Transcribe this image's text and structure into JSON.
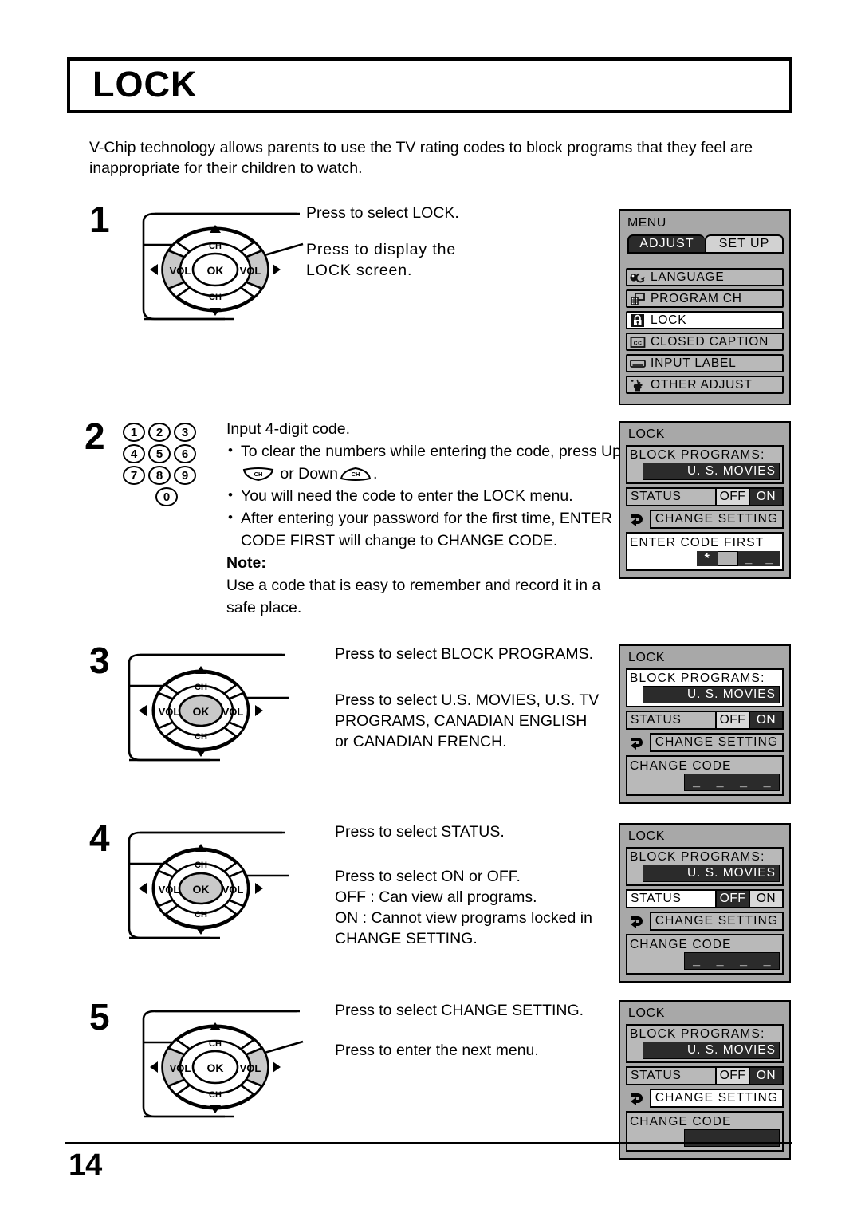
{
  "page": {
    "title": "LOCK",
    "intro": "V-Chip technology allows parents to use the TV rating codes to block programs that they feel are inappropriate for their children to watch.",
    "number": "14"
  },
  "steps": [
    {
      "num": "1",
      "callouts": [
        "Press to select LOCK.",
        "Press to display the\nLOCK screen."
      ]
    },
    {
      "num": "2",
      "lead": "Input 4-digit code.",
      "bullets": [
        "To clear the numbers while entering the code, press Up",
        "You will need the code to enter the LOCK menu.",
        "After entering your password for the first time, ENTER CODE FIRST will change to CHANGE CODE."
      ],
      "bullet1_tail": " or Down",
      "bullet1_end": ".",
      "note_label": "Note:",
      "note_text": "Use a code that is easy to remember and record it in a safe place.",
      "keypad": [
        [
          "1",
          "2",
          "3"
        ],
        [
          "4",
          "5",
          "6"
        ],
        [
          "7",
          "8",
          "9"
        ],
        [
          "0"
        ]
      ],
      "ch_button_label": "CH"
    },
    {
      "num": "3",
      "callouts": [
        "Press to select BLOCK PROGRAMS.",
        "Press to select U.S. MOVIES, U.S. TV\nPROGRAMS, CANADIAN ENGLISH\nor CANADIAN FRENCH."
      ]
    },
    {
      "num": "4",
      "callouts": [
        "Press to select STATUS.",
        "Press to select ON or OFF.\nOFF : Can view all programs.\nON  : Cannot view programs locked in\n         CHANGE SETTING."
      ]
    },
    {
      "num": "5",
      "callouts": [
        "Press to select CHANGE SETTING.",
        "Press to enter the next menu."
      ]
    }
  ],
  "remote": {
    "ok_label": "OK",
    "vol_label": "VOL",
    "ch_label": "CH"
  },
  "menu_screen": {
    "title": "MENU",
    "tabs": [
      {
        "label": "ADJUST",
        "active": true
      },
      {
        "label": "SET UP",
        "active": false
      }
    ],
    "items": [
      {
        "label": "LANGUAGE",
        "icon": "language-icon",
        "selected": false
      },
      {
        "label": "PROGRAM  CH",
        "icon": "program-ch-icon",
        "selected": false
      },
      {
        "label": "LOCK",
        "icon": "lock-icon",
        "selected": true
      },
      {
        "label": "CLOSED  CAPTION",
        "icon": "closed-caption-icon",
        "selected": false
      },
      {
        "label": "INPUT  LABEL",
        "icon": "input-label-icon",
        "selected": false
      },
      {
        "label": "OTHER  ADJUST",
        "icon": "other-adjust-icon",
        "selected": false
      }
    ]
  },
  "lock_screens": [
    {
      "id": "step2",
      "title": "LOCK",
      "block_label": "BLOCK  PROGRAMS:",
      "block_value": "U. S.  MOVIES",
      "block_highlight": false,
      "status_label": "STATUS",
      "status_off": "OFF",
      "status_on": "ON",
      "status_selected": "ON",
      "status_highlight": false,
      "change_setting_label": "CHANGE  SETTING",
      "change_setting_highlight": false,
      "code_label": "ENTER  CODE  FIRST",
      "code_highlight": true,
      "code_digits": [
        "*",
        "",
        "_",
        "_"
      ]
    },
    {
      "id": "step3",
      "title": "LOCK",
      "block_label": "BLOCK  PROGRAMS:",
      "block_value": "U. S.  MOVIES",
      "block_highlight": true,
      "status_label": "STATUS",
      "status_off": "OFF",
      "status_on": "ON",
      "status_selected": "ON",
      "status_highlight": false,
      "change_setting_label": "CHANGE  SETTING",
      "change_setting_highlight": false,
      "code_label": "CHANGE CODE",
      "code_highlight": false,
      "code_digits": [
        "_",
        "_",
        "_",
        "_"
      ]
    },
    {
      "id": "step4",
      "title": "LOCK",
      "block_label": "BLOCK  PROGRAMS:",
      "block_value": "U. S.  MOVIES",
      "block_highlight": false,
      "status_label": "STATUS",
      "status_off": "OFF",
      "status_on": "ON",
      "status_selected": "OFF",
      "status_highlight": true,
      "change_setting_label": "CHANGE  SETTING",
      "change_setting_highlight": false,
      "code_label": "CHANGE CODE",
      "code_highlight": false,
      "code_digits": [
        "_",
        "_",
        "_",
        "_"
      ]
    },
    {
      "id": "step5",
      "title": "LOCK",
      "block_label": "BLOCK  PROGRAMS:",
      "block_value": "U. S.  MOVIES",
      "block_highlight": false,
      "status_label": "STATUS",
      "status_off": "OFF",
      "status_on": "ON",
      "status_selected": "ON",
      "status_highlight": false,
      "change_setting_label": "CHANGE  SETTING",
      "change_setting_highlight": true,
      "code_label": "CHANGE CODE",
      "code_highlight": false,
      "code_digits": [
        "_",
        "_",
        "_",
        "_"
      ]
    }
  ],
  "colors": {
    "osd_background": "#a8a8a8",
    "osd_row": "#b9b9b9",
    "osd_dark": "#2b2b2b",
    "highlight": "#ffffff",
    "wedge_shaded": "#c9c9c9"
  }
}
